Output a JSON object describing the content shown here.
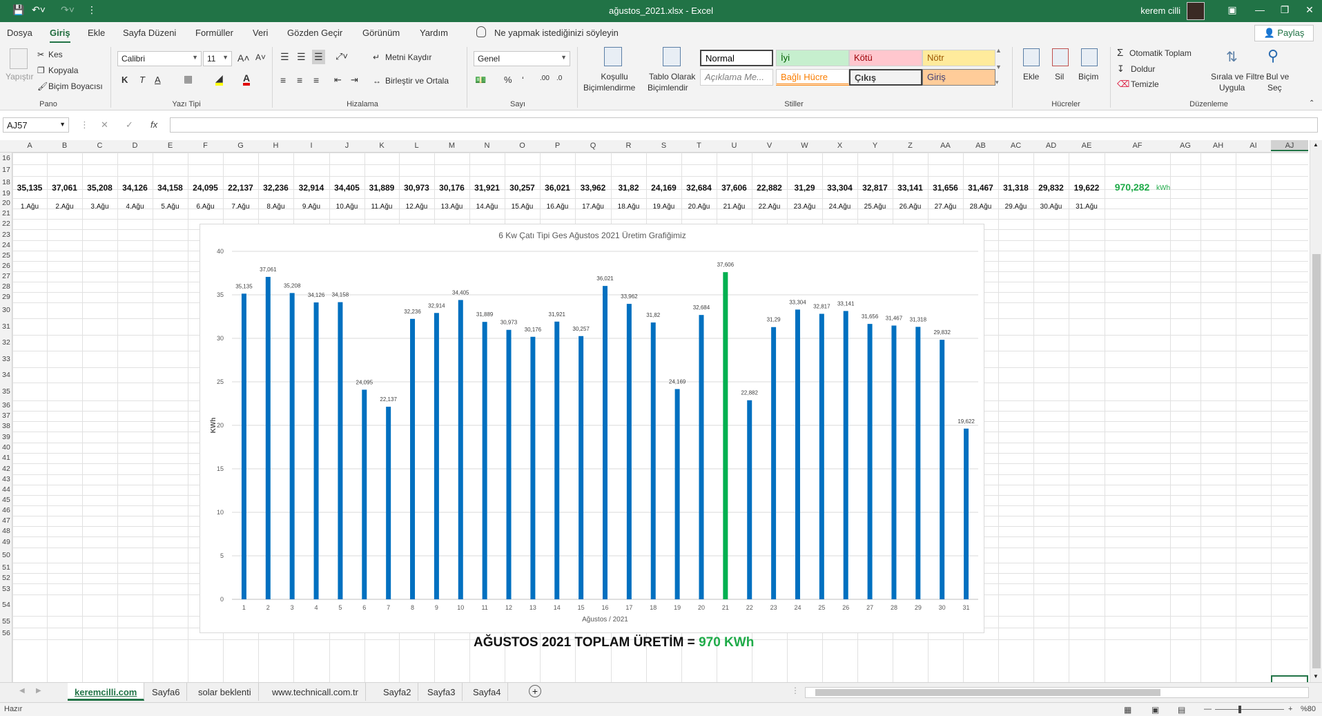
{
  "window": {
    "title": "ağustos_2021.xlsx  -  Excel",
    "user": "kerem cilli"
  },
  "menu": {
    "tabs": [
      "Dosya",
      "Giriş",
      "Ekle",
      "Sayfa Düzeni",
      "Formüller",
      "Veri",
      "Gözden Geçir",
      "Görünüm",
      "Yardım"
    ],
    "active_tab": "Giriş",
    "tell_me": "Ne yapmak istediğinizi söyleyin",
    "share": "Paylaş"
  },
  "ribbon": {
    "pano": {
      "label": "Pano",
      "paste": "Yapıştır",
      "cut": "Kes",
      "copy": "Kopyala",
      "format_painter": "Biçim Boyacısı"
    },
    "font": {
      "label": "Yazı Tipi",
      "name": "Calibri",
      "size": "11",
      "bold": "K",
      "italic": "T",
      "underline": "A"
    },
    "alignment": {
      "label": "Hizalama",
      "wrap": "Metni Kaydır",
      "merge": "Birleştir ve Ortala"
    },
    "number": {
      "label": "Sayı",
      "format": "Genel"
    },
    "styles": {
      "label": "Stiller",
      "conditional": [
        "Koşullu",
        "Biçimlendirme"
      ],
      "table": [
        "Tablo Olarak",
        "Biçimlendir"
      ],
      "cells": [
        {
          "name": "Normal",
          "bg": "#ffffff",
          "fg": "#000000"
        },
        {
          "name": "İyi",
          "bg": "#c6efce",
          "fg": "#006100"
        },
        {
          "name": "Kötü",
          "bg": "#ffc7ce",
          "fg": "#9c0006"
        },
        {
          "name": "Nötr",
          "bg": "#ffeb9c",
          "fg": "#9c5700"
        },
        {
          "name": "Açıklama Me...",
          "bg": "#ffffff",
          "fg": "#7f7f7f"
        },
        {
          "name": "Bağlı Hücre",
          "bg": "#ffffff",
          "fg": "#fa7d00"
        },
        {
          "name": "Çıkış",
          "bg": "#f2f2f2",
          "fg": "#3f3f3f"
        },
        {
          "name": "Giriş",
          "bg": "#ffcc99",
          "fg": "#3f3f76"
        }
      ]
    },
    "cells_group": {
      "label": "Hücreler",
      "insert": "Ekle",
      "delete": "Sil",
      "format": "Biçim"
    },
    "editing": {
      "label": "Düzenleme",
      "autosum": "Otomatik Toplam",
      "fill": "Doldur",
      "clear": "Temizle",
      "sort": [
        "Sırala ve Filtre",
        "Uygula"
      ],
      "find": [
        "Bul ve",
        "Seç"
      ]
    }
  },
  "formula_bar": {
    "name_box": "AJ57",
    "formula": ""
  },
  "sheet": {
    "columns": [
      "A",
      "B",
      "C",
      "D",
      "E",
      "F",
      "G",
      "H",
      "I",
      "J",
      "K",
      "L",
      "M",
      "N",
      "O",
      "P",
      "Q",
      "R",
      "S",
      "T",
      "U",
      "V",
      "W",
      "X",
      "Y",
      "Z",
      "AA",
      "AB",
      "AC",
      "AD",
      "AE",
      "AF",
      "AG",
      "AH",
      "AI",
      "AJ"
    ],
    "rows": [
      "16",
      "17",
      "18",
      "19",
      "20",
      "21",
      "22",
      "23",
      "24",
      "25",
      "26",
      "27",
      "28",
      "29",
      "30",
      "31",
      "32",
      "33",
      "34",
      "35",
      "36",
      "37",
      "38",
      "39",
      "40",
      "41",
      "42",
      "43",
      "44",
      "45",
      "46",
      "47",
      "48",
      "49",
      "50",
      "51",
      "52",
      "53",
      "54",
      "55",
      "56"
    ],
    "row18_values": [
      "35,135",
      "37,061",
      "35,208",
      "34,126",
      "34,158",
      "24,095",
      "22,137",
      "32,236",
      "32,914",
      "34,405",
      "31,889",
      "30,973",
      "30,176",
      "31,921",
      "30,257",
      "36,021",
      "33,962",
      "31,82",
      "24,169",
      "32,684",
      "37,606",
      "22,882",
      "31,29",
      "33,304",
      "32,817",
      "33,141",
      "31,656",
      "31,467",
      "31,318",
      "29,832",
      "19,622"
    ],
    "row18_total": "970,282",
    "row18_unit": "kWh",
    "row20_values": [
      "1.Ağu",
      "2.Ağu",
      "3.Ağu",
      "4.Ağu",
      "5.Ağu",
      "6.Ağu",
      "7.Ağu",
      "8.Ağu",
      "9.Ağu",
      "10.Ağu",
      "11.Ağu",
      "12.Ağu",
      "13.Ağu",
      "14.Ağu",
      "15.Ağu",
      "16.Ağu",
      "17.Ağu",
      "18.Ağu",
      "19.Ağu",
      "20.Ağu",
      "21.Ağu",
      "22.Ağu",
      "23.Ağu",
      "24.Ağu",
      "25.Ağu",
      "26.Ağu",
      "27.Ağu",
      "28.Ağu",
      "29.Ağu",
      "30.Ağu",
      "31.Ağu"
    ],
    "total_line": {
      "prefix": "AĞUSTOS 2021 TOPLAM ÜRETİM = ",
      "value": "970 KWh"
    }
  },
  "chart_data": {
    "type": "bar",
    "title": "6 Kw Çatı Tipi Ges Ağustos 2021 Üretim Grafiğimiz",
    "xlabel": "Ağustos / 2021",
    "ylabel": "KWh",
    "ylim": [
      0,
      40
    ],
    "yticks": [
      0,
      5,
      10,
      15,
      20,
      25,
      30,
      35,
      40
    ],
    "grid": true,
    "categories": [
      "1",
      "2",
      "3",
      "4",
      "5",
      "6",
      "7",
      "8",
      "9",
      "10",
      "11",
      "12",
      "13",
      "14",
      "15",
      "16",
      "17",
      "18",
      "19",
      "20",
      "21",
      "22",
      "23",
      "24",
      "25",
      "26",
      "27",
      "28",
      "29",
      "30",
      "31"
    ],
    "values": [
      35.135,
      37.061,
      35.208,
      34.126,
      34.158,
      24.095,
      22.137,
      32.236,
      32.914,
      34.405,
      31.889,
      30.973,
      30.176,
      31.921,
      30.257,
      36.021,
      33.962,
      31.82,
      24.169,
      32.684,
      37.606,
      22.882,
      31.29,
      33.304,
      32.817,
      33.141,
      31.656,
      31.467,
      31.318,
      29.832,
      19.622
    ],
    "data_labels": [
      "35,135",
      "37,061",
      "35,208",
      "34,126",
      "34,158",
      "24,095",
      "22,137",
      "32,236",
      "32,914",
      "34,405",
      "31,889",
      "30,973",
      "30,176",
      "31,921",
      "30,257",
      "36,021",
      "33,962",
      "31,82",
      "24,169",
      "32,684",
      "37,606",
      "22,882",
      "31,29",
      "33,304",
      "32,817",
      "33,141",
      "31,656",
      "31,467",
      "31,318",
      "29,832",
      "19,622"
    ],
    "bar_color": "#0070c0",
    "highlight_index": 20,
    "highlight_color": "#00b050"
  },
  "sheet_tabs": [
    "keremcilli.com",
    "Sayfa6",
    "solar beklenti",
    "www.technicall.com.tr",
    "Sayfa2",
    "Sayfa3",
    "Sayfa4"
  ],
  "active_sheet": "keremcilli.com",
  "status": {
    "ready": "Hazır",
    "zoom": "%80"
  },
  "colors": {
    "excel_green": "#217346",
    "total_green": "#1fab49"
  }
}
